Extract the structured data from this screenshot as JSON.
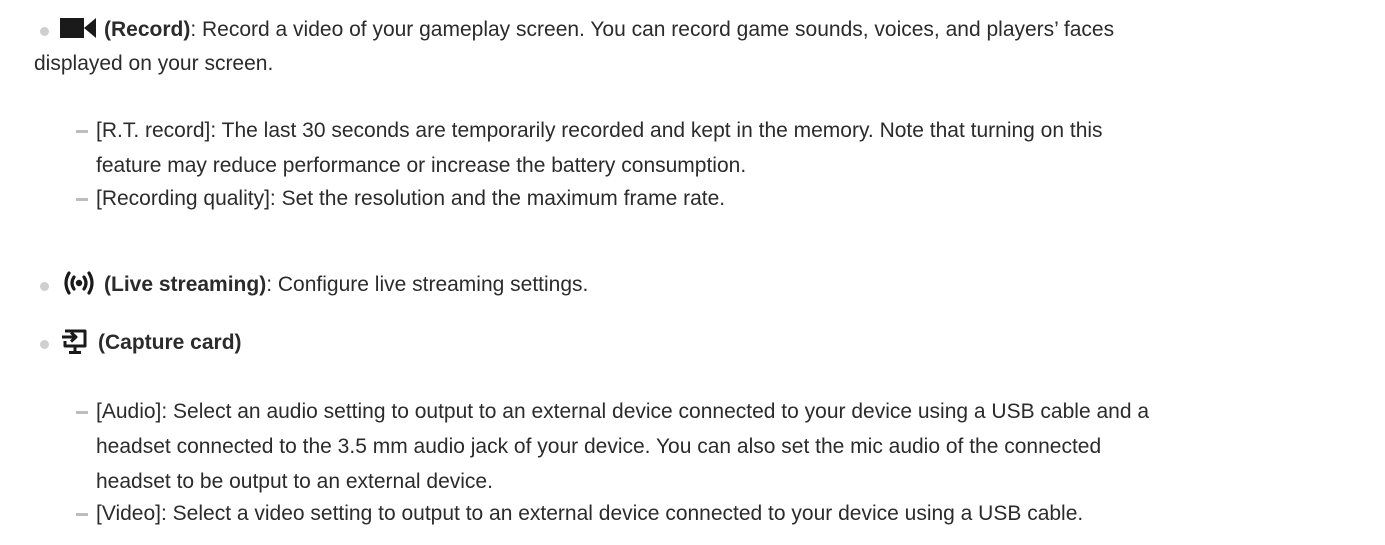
{
  "items": [
    {
      "title": "(Record)",
      "icon": "video-camera-icon",
      "rest_line1": ": Record a video of your gameplay screen. You can record game sounds, voices, and players’ faces",
      "rest_line2": "displayed on your screen.",
      "subitems": [
        {
          "line1": "[R.T. record]: The last 30 seconds are temporarily recorded and kept in the memory. Note that turning on this",
          "line2": "feature may reduce performance or increase the battery consumption."
        },
        {
          "line1": "[Recording quality]: Set the resolution and the maximum frame rate."
        }
      ]
    },
    {
      "title": "(Live streaming)",
      "icon": "broadcast-icon",
      "rest": ": Configure live streaming settings."
    },
    {
      "title": "(Capture card)",
      "icon": "capture-input-icon",
      "subitems": [
        {
          "line1": "[Audio]: Select an audio setting to output to an external device connected to your device using a USB cable and a",
          "line2": "headset connected to the 3.5 mm audio jack of your device. You can also set the mic audio of the connected",
          "line3": "headset to be output to an external device."
        },
        {
          "line1": "[Video]: Select a video setting to output to an external device connected to your device using a USB cable."
        }
      ]
    }
  ]
}
